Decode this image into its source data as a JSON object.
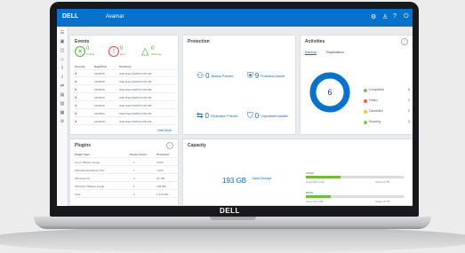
{
  "window": {
    "logo": "DELL",
    "title": "Avamar"
  },
  "laptop": {
    "brand": "DELL"
  },
  "events": {
    "title": "Events",
    "critical": {
      "count": "0",
      "label": "Critical"
    },
    "error": {
      "count": "0",
      "label": "Error"
    },
    "warning": {
      "count": "0",
      "label": "Warning"
    },
    "columns": [
      "Severity",
      "Date/Time",
      "Summary"
    ],
    "rows": [
      [
        "",
        "10/28/19",
        "Start Date 5/26/19 6:00 AM"
      ],
      [
        "",
        "10/28/19",
        "Start Date 5/26/19 6:00 AM"
      ],
      [
        "",
        "10/28/19",
        "Start Date 5/26/19 6:00 AM"
      ],
      [
        "",
        "10/28/19",
        "Start Date 5/26/19 6:00 AM"
      ],
      [
        "",
        "10/28/19",
        "Start Date 5/26/19 6:00 AM"
      ],
      [
        "",
        "10/28/19",
        "Start Date 5/26/19 6:00 AM"
      ],
      [
        "",
        "10/28/19",
        "Start Date 5/26/19 6:00 AM"
      ]
    ],
    "view_more": "View More"
  },
  "protection": {
    "title": "Protection",
    "backup": {
      "count": "0",
      "label": "Backup Policies"
    },
    "protected": {
      "count": "9",
      "label": "Protection Assets"
    },
    "replication": {
      "count": "0",
      "label": "Replication Policies"
    },
    "unprotected": {
      "count": "0",
      "label": "Unprotected Assets"
    }
  },
  "activities": {
    "title": "Activities",
    "tabs": [
      "Backup",
      "Replication"
    ],
    "total": "6",
    "legend": [
      {
        "label": "Completed",
        "value": "6",
        "color": "#7ac143"
      },
      {
        "label": "Failed",
        "value": "0",
        "color": "#e35e5e"
      },
      {
        "label": "Cancelled",
        "value": "0",
        "color": "#f2c43d"
      },
      {
        "label": "Running",
        "value": "0",
        "color": "#8bc34a"
      }
    ]
  },
  "plugins": {
    "title": "Plugins",
    "columns": [
      "Plugin Type",
      "Server Count",
      "Protected"
    ],
    "rows": [
      [
        "Linux VMware Image",
        "1",
        "3,000"
      ],
      [
        "Windows Exchange VSS",
        "1",
        "7,900"
      ],
      [
        "Windows FS",
        "3",
        "20,700"
      ],
      [
        "Windows VMware Image",
        "1",
        "138,900"
      ],
      [
        "Total",
        "6",
        "1,170,300"
      ]
    ]
  },
  "capacity": {
    "title": "Capacity",
    "used": "193 GB",
    "used_label": "Used Storage",
    "bars": [
      {
        "name": "GSAN",
        "left": "Used 193.9 GB",
        "right": "Total 3.9 TB",
        "fill": 0.35
      },
      {
        "name": "DDVE",
        "left": "Used 41.9 GB",
        "right": "Total 1.9 TB",
        "fill": 0.25
      }
    ]
  }
}
